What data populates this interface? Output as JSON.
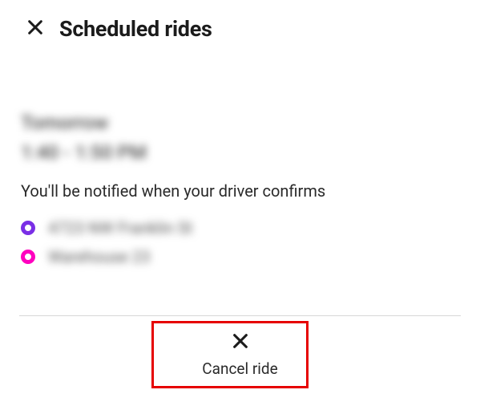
{
  "header": {
    "title": "Scheduled rides",
    "close_icon": "close-icon"
  },
  "ride": {
    "day": "Tomorrow",
    "time": "1:40 - 1:50 PM",
    "notice": "You'll be notified when your driver confirms",
    "stops": [
      {
        "color": "purple",
        "text": "4723 NW Franklin St"
      },
      {
        "color": "magenta",
        "text": "Warehouse 23"
      }
    ]
  },
  "footer": {
    "cancel_label": "Cancel ride",
    "cancel_icon": "close-icon"
  },
  "colors": {
    "accent_purple": "#7a2fe6",
    "accent_magenta": "#ff00bf",
    "highlight_red": "#e60000"
  }
}
